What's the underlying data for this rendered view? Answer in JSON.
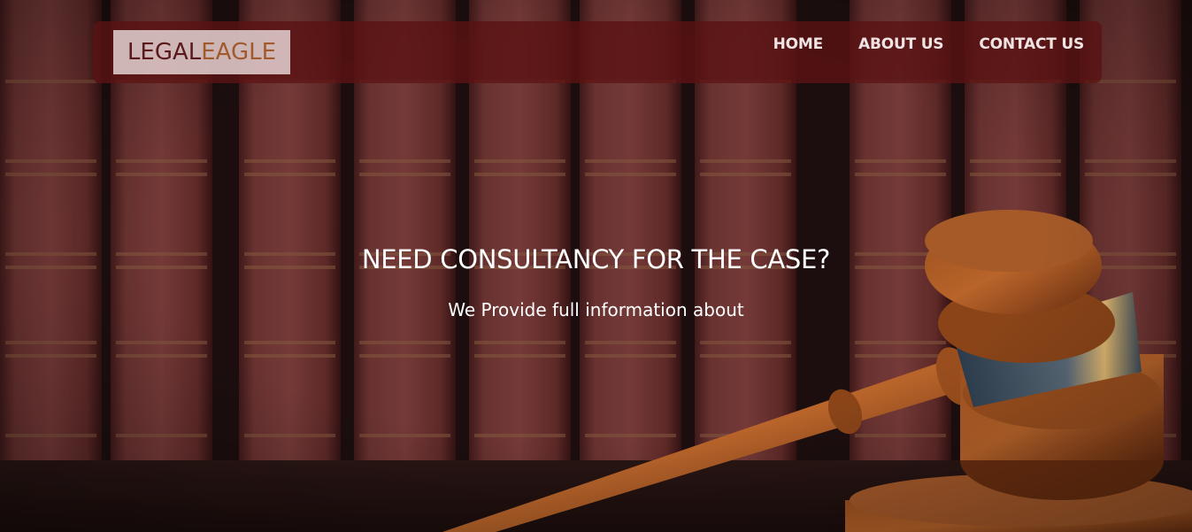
{
  "brand": {
    "part1": "LEGAL",
    "part2": "EAGLE",
    "color1": "#5a1a1c",
    "color2": "#a05a2c"
  },
  "nav": {
    "items": [
      "HOME",
      "ABOUT US",
      "CONTACT US"
    ]
  },
  "hero": {
    "headline": "NEED CONSULTANCY FOR THE CASE?",
    "subtext": "We Provide full information about"
  },
  "colors": {
    "navbar": "#5a1214",
    "book": "#6e3230",
    "wood": "#7a3a17"
  }
}
